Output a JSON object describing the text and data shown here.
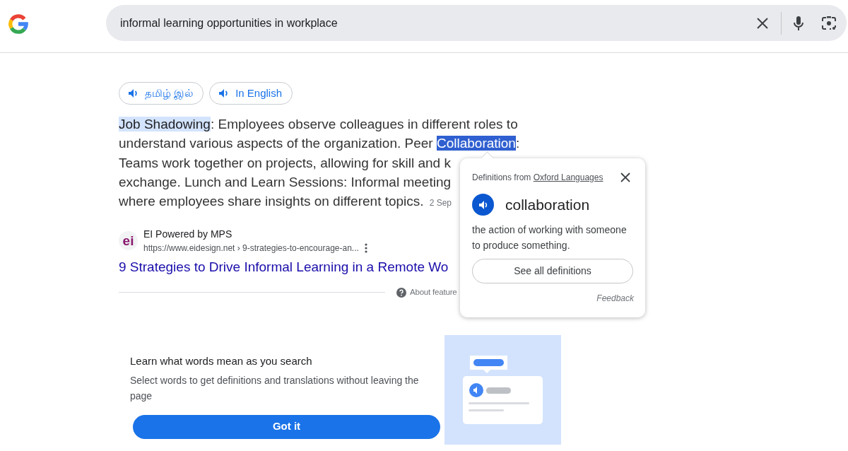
{
  "search": {
    "query": "informal learning opportunities in workplace"
  },
  "language_buttons": [
    {
      "label": "தமிழ் இல்"
    },
    {
      "label": "In English"
    }
  ],
  "snippet": {
    "lines": [
      [
        {
          "text": "Job Shadowing",
          "highlighted": true,
          "selected": false
        },
        {
          "text": ": Employees observe colleagues in different roles to",
          "highlighted": false,
          "selected": false
        }
      ],
      [
        {
          "text": "understand various aspects of the organization. Peer ",
          "highlighted": false,
          "selected": false
        },
        {
          "text": "Collaboration",
          "highlighted": false,
          "selected": true
        },
        {
          "text": ":",
          "highlighted": false,
          "selected": false
        }
      ],
      [
        {
          "text": "Teams work together on projects, allowing for skill and k",
          "highlighted": false,
          "selected": false
        }
      ],
      [
        {
          "text": "exchange. Lunch and Learn Sessions: Informal meeting",
          "highlighted": false,
          "selected": false
        }
      ],
      [
        {
          "text": "where employees share insights on different topics.",
          "highlighted": false,
          "selected": false
        }
      ]
    ],
    "date": "2 Sep"
  },
  "source": {
    "logo_text": "ei",
    "name": "EI Powered by MPS",
    "url": "https://www.eidesign.net › 9-strategies-to-encourage-an...",
    "title": "9 Strategies to Drive Informal Learning in a Remote Wo"
  },
  "about_feature": "About feature",
  "definition_popup": {
    "source_prefix": "Definitions from",
    "source_link": "Oxford Languages",
    "word": "collaboration",
    "definition": "the action of working with someone to produce something.",
    "button": "See all definitions",
    "feedback": "Feedback"
  },
  "onboarding": {
    "title": "Learn what words mean as you search",
    "text": "Select words to get definitions and translations without leaving the page",
    "button": "Got it"
  }
}
